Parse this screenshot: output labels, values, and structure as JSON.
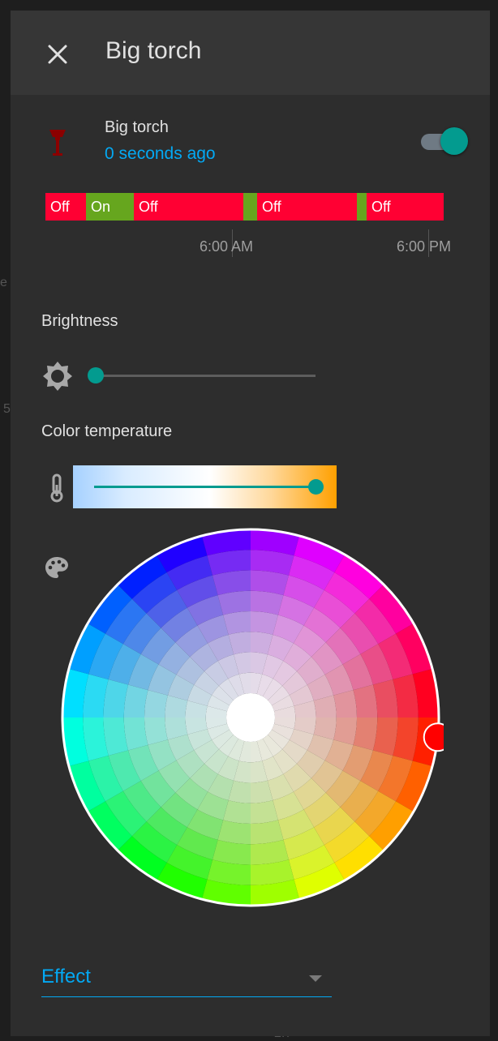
{
  "dialog": {
    "title": "Big torch",
    "close_icon": "close-icon"
  },
  "entity": {
    "name": "Big torch",
    "last_changed": "0 seconds ago",
    "icon": "torch-icon",
    "state_on": true,
    "icon_color": "#8b0000"
  },
  "history": {
    "segments": [
      {
        "label": "Off",
        "state": "off"
      },
      {
        "label": "On",
        "state": "on"
      },
      {
        "label": "Off",
        "state": "off"
      },
      {
        "label": "",
        "state": "on"
      },
      {
        "label": "Off",
        "state": "off"
      },
      {
        "label": "",
        "state": "on"
      },
      {
        "label": "Off",
        "state": "off"
      }
    ],
    "ticks": [
      "6:00 AM",
      "6:00 PM"
    ],
    "colors": {
      "off": "#ff0033",
      "on": "#66a61e"
    }
  },
  "brightness": {
    "label": "Brightness",
    "icon": "brightness-icon",
    "value": 0
  },
  "color_temp": {
    "label": "Color temperature",
    "icon": "thermometer-icon",
    "value": 1.0
  },
  "color": {
    "icon": "palette-icon",
    "selected_hue": 0,
    "selected_color": "#ff0000"
  },
  "effect": {
    "label": "Effect",
    "icon": "dropdown-arrow-icon"
  },
  "theme": {
    "accent": "#03a9f4",
    "primary": "#039b8f",
    "background": "#2d2d2d"
  }
}
